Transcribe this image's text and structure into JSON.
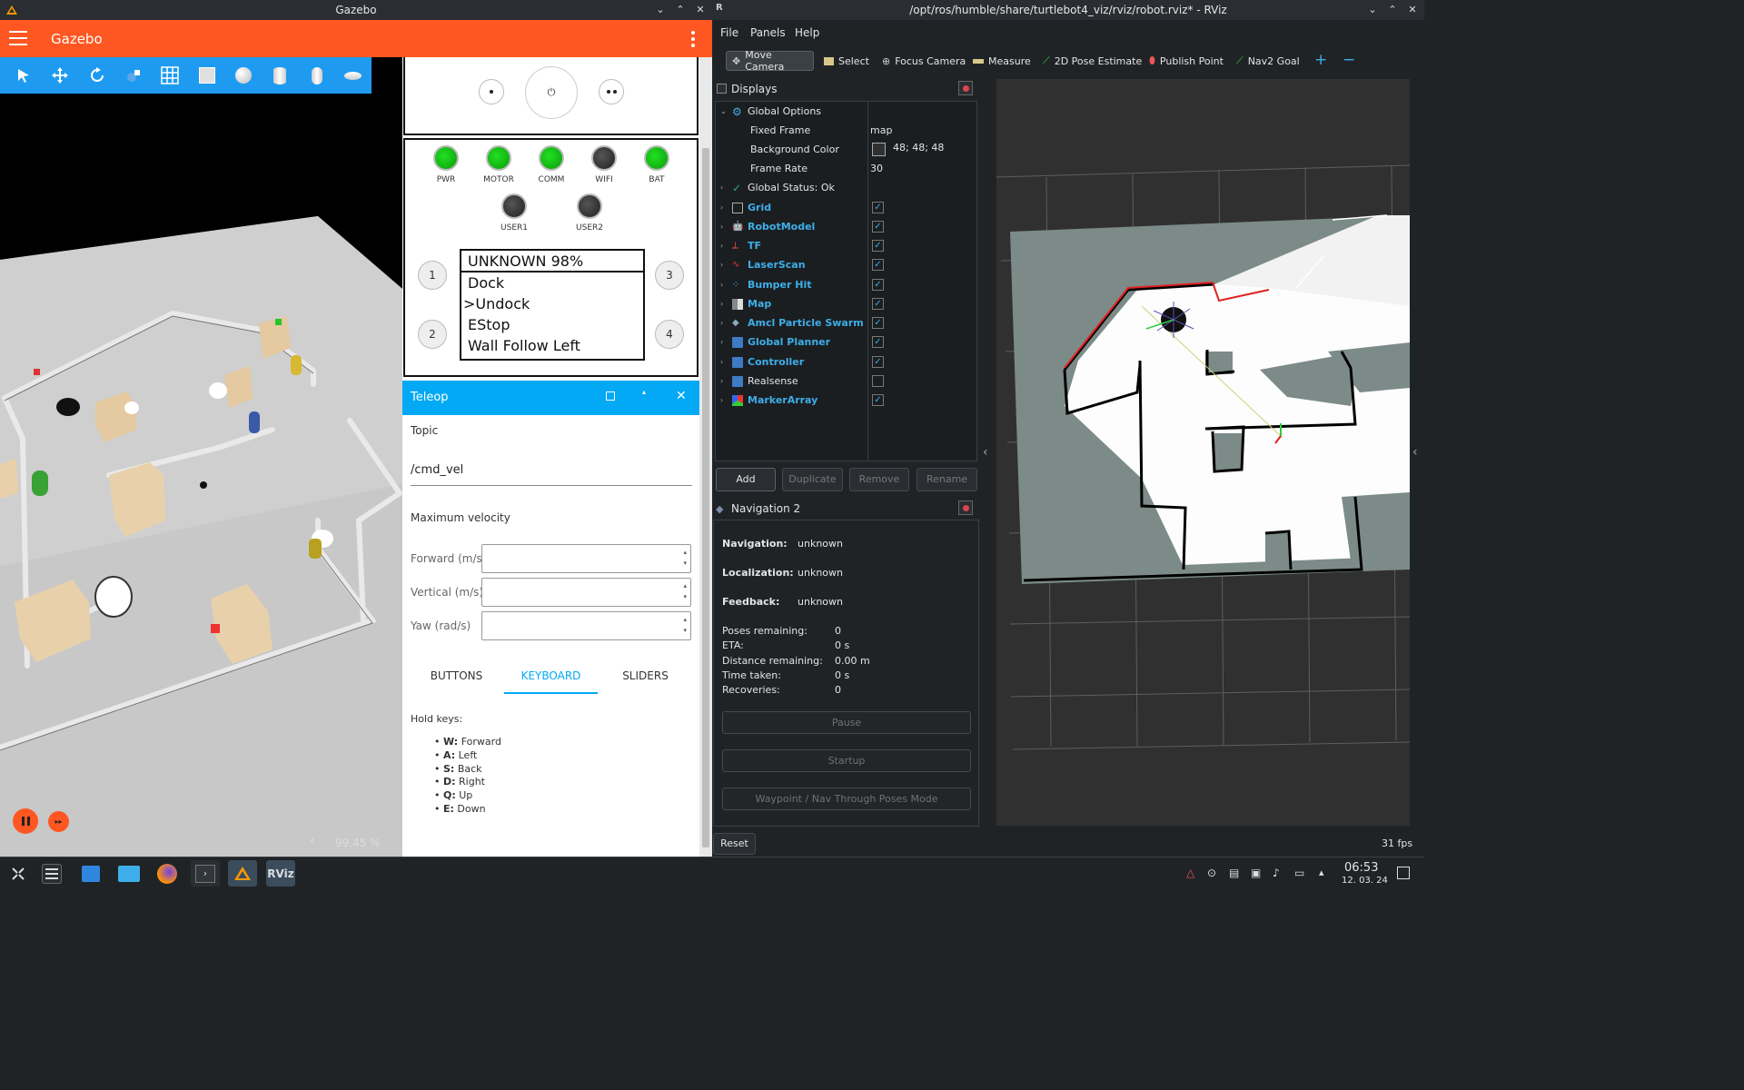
{
  "gazebo": {
    "window_title": "Gazebo",
    "app_title": "Gazebo",
    "power_button": "⏻",
    "leds": [
      {
        "label": "PWR",
        "state": "on"
      },
      {
        "label": "MOTOR",
        "state": "on"
      },
      {
        "label": "COMM",
        "state": "on"
      },
      {
        "label": "WIFI",
        "state": "off"
      },
      {
        "label": "BAT",
        "state": "on"
      },
      {
        "label": "USER1",
        "state": "off"
      },
      {
        "label": "USER2",
        "state": "off"
      }
    ],
    "number_buttons": [
      "1",
      "2",
      "3",
      "4"
    ],
    "display_lines": [
      "UNKNOWN 98%",
      "Dock",
      ">Undock",
      "EStop",
      "Wall Follow Left"
    ],
    "teleop": {
      "title": "Teleop",
      "topic_label": "Topic",
      "topic_value": "/cmd_vel",
      "max_velocity_label": "Maximum velocity",
      "forward_label": "Forward (m/s)",
      "vertical_label": "Vertical (m/s)",
      "yaw_label": "Yaw (rad/s)",
      "tabs": [
        "BUTTONS",
        "KEYBOARD",
        "SLIDERS"
      ],
      "active_tab": "KEYBOARD",
      "hold_keys_label": "Hold keys:",
      "keys": [
        {
          "key": "W:",
          "action": " Forward"
        },
        {
          "key": "A:",
          "action": " Left"
        },
        {
          "key": "S:",
          "action": " Back"
        },
        {
          "key": "D:",
          "action": " Right"
        },
        {
          "key": "Q:",
          "action": " Up"
        },
        {
          "key": "E:",
          "action": " Down"
        }
      ]
    },
    "rtf": "99.45 %",
    "collapse_arrow": "‹",
    "accent_color": "#ff5722",
    "toolbar_color": "#1e9bf0"
  },
  "rviz": {
    "window_title": "/opt/ros/humble/share/turtlebot4_viz/rviz/robot.rviz* - RViz",
    "menu": [
      "File",
      "Panels",
      "Help"
    ],
    "tools": [
      "Move Camera",
      "Select",
      "Focus Camera",
      "Measure",
      "2D Pose Estimate",
      "Publish Point",
      "Nav2 Goal"
    ],
    "displays": {
      "title": "Displays",
      "global_options": "Global Options",
      "options": [
        {
          "name": "Fixed Frame",
          "value": "map"
        },
        {
          "name": "Background Color",
          "value": "48; 48; 48"
        },
        {
          "name": "Frame Rate",
          "value": "30"
        }
      ],
      "global_status": "Global Status: Ok",
      "items": [
        {
          "name": "Grid",
          "checked": true,
          "icon": "grid-icon"
        },
        {
          "name": "RobotModel",
          "checked": true,
          "icon": "robot-icon"
        },
        {
          "name": "TF",
          "checked": true,
          "icon": "tf-icon"
        },
        {
          "name": "LaserScan",
          "checked": true,
          "icon": "laser-icon"
        },
        {
          "name": "Bumper Hit",
          "checked": true,
          "icon": "bumper-icon"
        },
        {
          "name": "Map",
          "checked": true,
          "icon": "map-icon"
        },
        {
          "name": "Amcl Particle Swarm",
          "checked": true,
          "icon": "particle-icon"
        },
        {
          "name": "Global Planner",
          "checked": true,
          "icon": "folder-icon"
        },
        {
          "name": "Controller",
          "checked": true,
          "icon": "folder-icon"
        },
        {
          "name": "Realsense",
          "checked": false,
          "icon": "folder-icon"
        },
        {
          "name": "MarkerArray",
          "checked": true,
          "icon": "marker-icon"
        }
      ],
      "buttons": [
        "Add",
        "Duplicate",
        "Remove",
        "Rename"
      ]
    },
    "nav2": {
      "title": "Navigation 2",
      "navigation_label": "Navigation:",
      "navigation_value": "unknown",
      "localization_label": "Localization:",
      "localization_value": "unknown",
      "feedback_label": "Feedback:",
      "feedback_value": "unknown",
      "stats": [
        {
          "label": "Poses remaining:",
          "value": "0"
        },
        {
          "label": "ETA:",
          "value": "0 s"
        },
        {
          "label": "Distance remaining:",
          "value": "0.00 m"
        },
        {
          "label": "Time taken:",
          "value": "0 s"
        },
        {
          "label": "Recoveries:",
          "value": "0"
        }
      ],
      "buttons": [
        "Pause",
        "Startup",
        "Waypoint / Nav Through Poses Mode"
      ]
    },
    "reset_label": "Reset",
    "fps": "31 fps",
    "left_arrow": "‹",
    "right_arrow": "‹"
  },
  "taskbar": {
    "time": "06:53",
    "date": "12. 03. 24",
    "rviz_label": "RViz"
  }
}
